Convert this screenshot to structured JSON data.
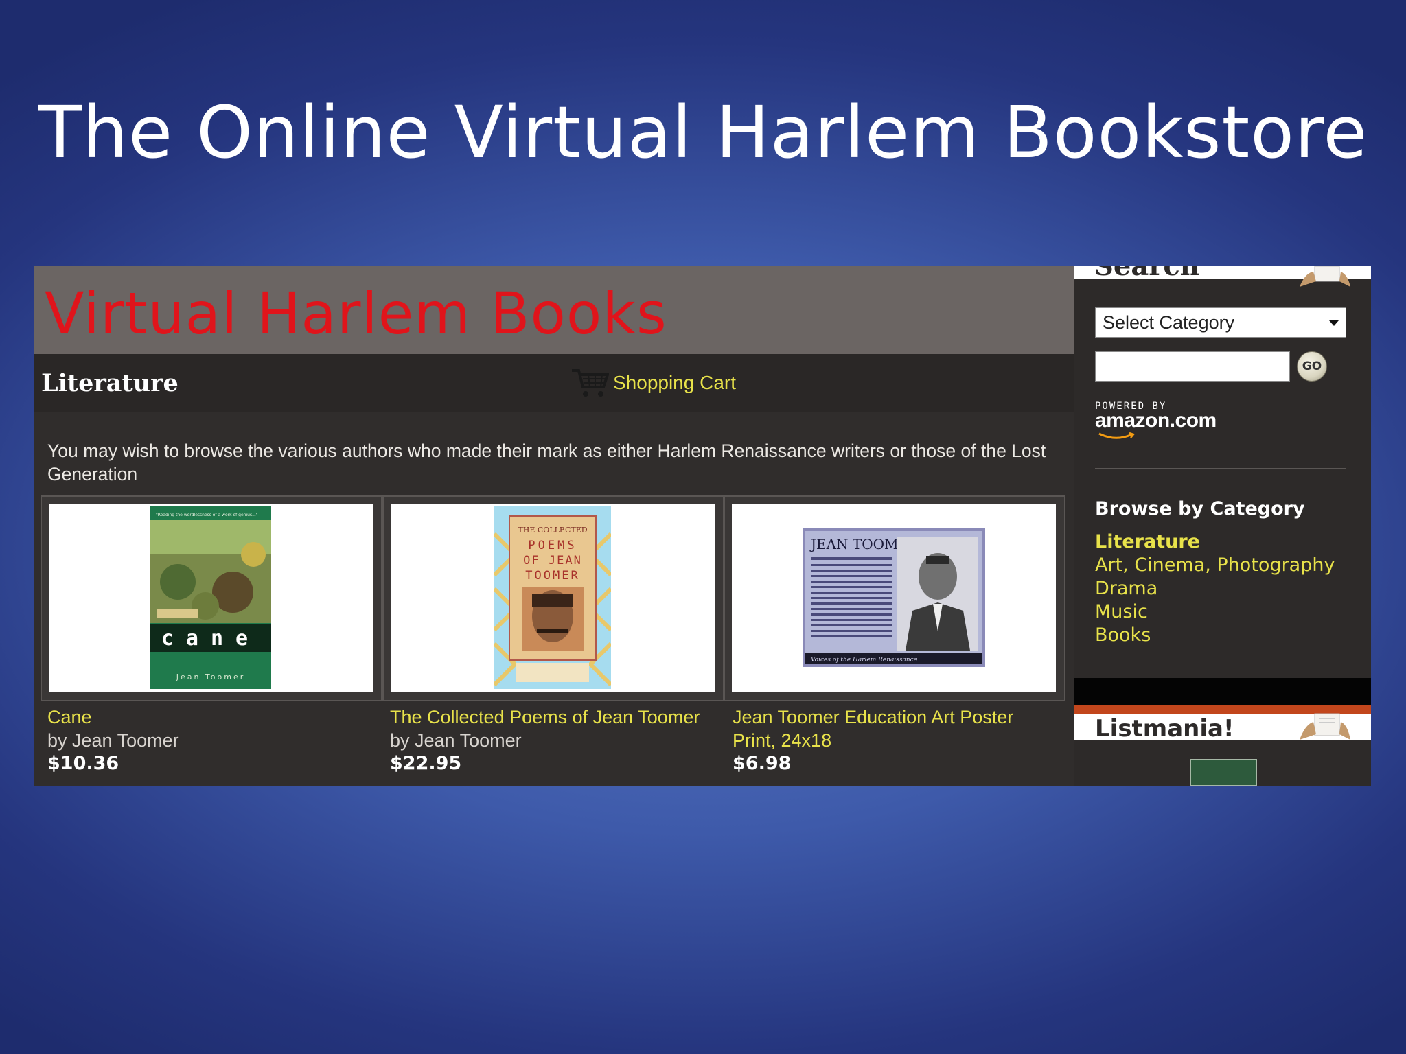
{
  "slide": {
    "title": "The Online Virtual Harlem Bookstore"
  },
  "site": {
    "banner_title": "Virtual Harlem Books",
    "section_title": "Literature",
    "cart_label": "Shopping Cart",
    "intro_text": "You may wish to browse the various authors who made their mark as either Harlem Renaissance writers or those of the Lost Generation"
  },
  "products": [
    {
      "name": "Cane",
      "by": "by Jean Toomer",
      "price": "$10.36",
      "cover": {
        "letters": "cane",
        "author": "Jean Toomer"
      }
    },
    {
      "name": "The Collected Poems of Jean Toomer",
      "by": "by Jean Toomer",
      "price": "$22.95",
      "cover": {
        "line1": "THE COLLECTED",
        "line2": "POEMS",
        "line3": "OF JEAN",
        "line4": "TOOMER"
      }
    },
    {
      "name": "Jean Toomer Education Art Poster Print, 24x18",
      "by": "",
      "price": "$6.98",
      "cover": {
        "heading": "JEAN TOOMER",
        "caption": "Voices of the Harlem Renaissance"
      }
    }
  ],
  "sidebar": {
    "search_heading": "Search",
    "select_value": "Select Category",
    "search_value": "",
    "go_label": "GO",
    "powered_by": "POWERED BY",
    "amazon_logo": "amazon.com",
    "browse_title": "Browse by Category",
    "categories": [
      "Literature",
      "Art, Cinema, Photography",
      "Drama",
      "Music",
      "Books"
    ],
    "listmania_label": "Listmania!"
  },
  "colors": {
    "banner_red": "#e0141b",
    "link_yellow": "#e8e24a",
    "panel_dark": "#2d2a29",
    "listmania_orange": "#c2461c"
  }
}
